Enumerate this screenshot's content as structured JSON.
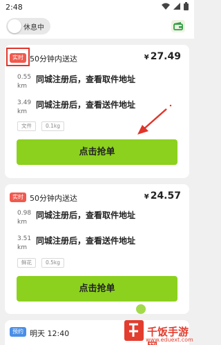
{
  "status_bar": {
    "time": "2:48"
  },
  "top_bar": {
    "toggle_label": "休息中"
  },
  "orders": [
    {
      "badge": "实时",
      "delivery": "50分钟内送达",
      "currency": "¥",
      "price": "27.49",
      "pickup": {
        "distance": "0.55",
        "unit": "km",
        "address": "同城注册后，查看取件地址"
      },
      "dropoff": {
        "distance": "3.49",
        "unit": "km",
        "address": "同城注册后，查看送件地址"
      },
      "tags": [
        "文件",
        "0.1kg"
      ],
      "button": "点击抢单"
    },
    {
      "badge": "实时",
      "delivery": "50分钟内送达",
      "currency": "¥",
      "price": "24.57",
      "pickup": {
        "distance": "0.98",
        "unit": "km",
        "address": "同城注册后，查看取件地址"
      },
      "dropoff": {
        "distance": "3.51",
        "unit": "km",
        "address": "同城注册后，查看送件地址"
      },
      "tags": [
        "鲜花",
        "0.5kg"
      ],
      "button": "点击抢单"
    },
    {
      "badge": "预约",
      "schedule": "明天 12:40"
    }
  ],
  "watermark": {
    "name": "千饭手游网",
    "url": "www.eduext.com"
  },
  "colors": {
    "accent_green": "#8cd11e",
    "badge_red": "#f05a4e",
    "badge_blue": "#4a8fe7",
    "annotation_red": "#e0352b"
  }
}
